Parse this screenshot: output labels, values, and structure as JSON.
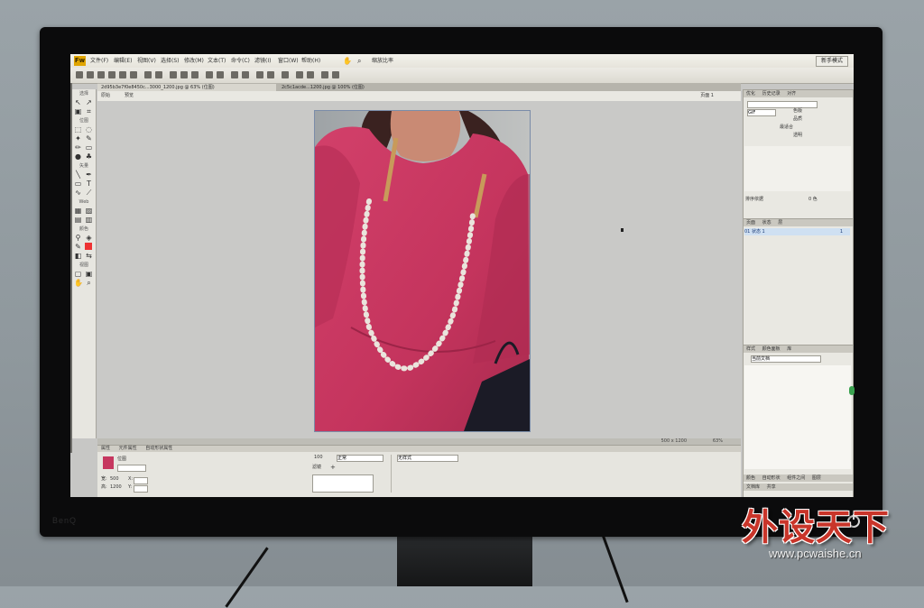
{
  "app": {
    "logo": "Fw",
    "menus": [
      "文件(F)",
      "编辑(E)",
      "视图(V)",
      "选择(S)",
      "修改(M)",
      "文本(T)",
      "命令(C)",
      "滤镜(I)",
      "窗口(W)",
      "帮助(H)"
    ],
    "zoom_dropdown": "缩放比率",
    "workspace_mode": "新手模式"
  },
  "tabs": [
    {
      "label": "2d95b3e7f0e8450c...3000_1200.jpg @ 63% (位图)",
      "active": true
    },
    {
      "label": "2c5c1acde...1200.jpg @ 100% (位图)",
      "active": false
    }
  ],
  "docbar": {
    "original": "原始",
    "preview": "预览",
    "pages": "页面 1"
  },
  "tools": {
    "sections": [
      "选择",
      "位图",
      "矢量",
      "Web",
      "颜色",
      "视图"
    ]
  },
  "status": {
    "size": "500 x 1200",
    "zoom": "63%"
  },
  "properties": {
    "tabs": [
      "属性",
      "元件属性",
      "自动形状属性"
    ],
    "object_label": "位图",
    "width_label": "宽:",
    "width_value": "500",
    "height_label": "高:",
    "height_value": "1200",
    "x_label": "X:",
    "y_label": "Y:",
    "opacity_value": "100",
    "blend_mode": "正常",
    "filter_label": "滤镜",
    "style_select": "无样式"
  },
  "optimize_panel": {
    "tabs": [
      "优化",
      "历史记录",
      "对齐"
    ],
    "format": "GIF",
    "palette": "最适合",
    "quality_label": "品质",
    "matte_label": "色版",
    "alpha_label": "透明",
    "dither_label": "抖动",
    "sort_label": "排序依据",
    "colors_label": "0 色"
  },
  "layers_panel": {
    "tabs": [
      "页面",
      "状态",
      "层"
    ],
    "row_label": "01  状态 1",
    "row_count": "1"
  },
  "styles_panel": {
    "tabs": [
      "样式",
      "颜色面板",
      "库"
    ],
    "select": "当前文档",
    "bottom_tabs": [
      "颜色",
      "自动形状",
      "组件之间",
      "图层"
    ],
    "bottom_tabs2": [
      "文档库",
      "共享"
    ]
  },
  "watermark": {
    "cn": "外设天下",
    "url": "www.pcwaishe.cn"
  },
  "monitor_brand": "BenQ",
  "colors": {
    "dress": "#c6375f",
    "watermark_red": "#c9352a",
    "accent_blue": "#cfe0f2"
  }
}
